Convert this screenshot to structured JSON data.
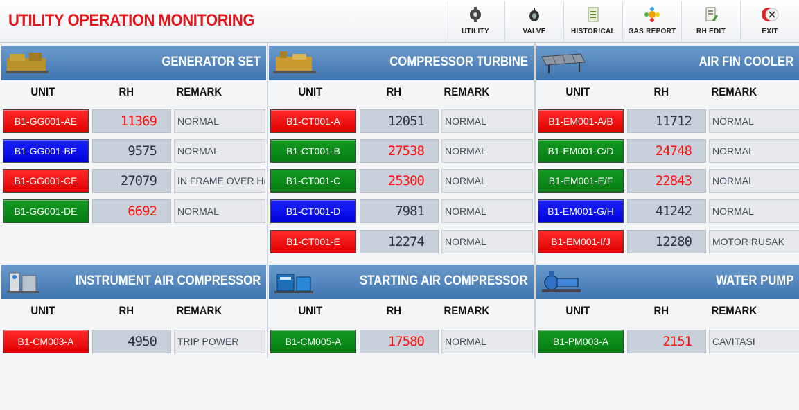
{
  "header": {
    "title": "UTILITY OPERATION MONITORING"
  },
  "toolbar": [
    {
      "label": "UTILITY",
      "icon": "utility-icon"
    },
    {
      "label": "VALVE",
      "icon": "valve-icon"
    },
    {
      "label": "HISTORICAL",
      "icon": "historical-icon"
    },
    {
      "label": "GAS REPORT",
      "icon": "gas-report-icon"
    },
    {
      "label": "RH EDIT",
      "icon": "rh-edit-icon"
    },
    {
      "label": "EXIT",
      "icon": "exit-icon"
    }
  ],
  "columns": {
    "unit": "UNIT",
    "rh": "RH",
    "remark": "REMARK"
  },
  "panels": {
    "generator_set": {
      "title": "GENERATOR SET",
      "rows": [
        {
          "unit": "B1-GG001-AE",
          "color": "red",
          "rh": "11369",
          "rh_color": "red",
          "remark": "NORMAL"
        },
        {
          "unit": "B1-GG001-BE",
          "color": "blue",
          "rh": "9575",
          "rh_color": "dark",
          "remark": "NORMAL"
        },
        {
          "unit": "B1-GG001-CE",
          "color": "red",
          "rh": "27079",
          "rh_color": "dark",
          "remark": "IN FRAME OVER H("
        },
        {
          "unit": "B1-GG001-DE",
          "color": "green",
          "rh": "6692",
          "rh_color": "red",
          "remark": "NORMAL"
        }
      ]
    },
    "compressor_turbine": {
      "title": "COMPRESSOR TURBINE",
      "rows": [
        {
          "unit": "B1-CT001-A",
          "color": "red",
          "rh": "12051",
          "rh_color": "dark",
          "remark": "NORMAL"
        },
        {
          "unit": "B1-CT001-B",
          "color": "green",
          "rh": "27538",
          "rh_color": "red",
          "remark": "NORMAL"
        },
        {
          "unit": "B1-CT001-C",
          "color": "green",
          "rh": "25300",
          "rh_color": "red",
          "remark": "NORMAL"
        },
        {
          "unit": "B1-CT001-D",
          "color": "blue",
          "rh": "7981",
          "rh_color": "dark",
          "remark": "NORMAL"
        },
        {
          "unit": "B1-CT001-E",
          "color": "red",
          "rh": "12274",
          "rh_color": "dark",
          "remark": "NORMAL"
        }
      ]
    },
    "air_fin_cooler": {
      "title": "AIR FIN COOLER",
      "rows": [
        {
          "unit": "B1-EM001-A/B",
          "color": "red",
          "rh": "11712",
          "rh_color": "dark",
          "remark": "NORMAL"
        },
        {
          "unit": "B1-EM001-C/D",
          "color": "green",
          "rh": "24748",
          "rh_color": "red",
          "remark": "NORMAL"
        },
        {
          "unit": "B1-EM001-E/F",
          "color": "green",
          "rh": "22843",
          "rh_color": "red",
          "remark": "NORMAL"
        },
        {
          "unit": "B1-EM001-G/H",
          "color": "blue",
          "rh": "41242",
          "rh_color": "dark",
          "remark": "NORMAL"
        },
        {
          "unit": "B1-EM001-I/J",
          "color": "red",
          "rh": "12280",
          "rh_color": "dark",
          "remark": "MOTOR RUSAK"
        }
      ]
    },
    "instrument_air_compressor": {
      "title": "INSTRUMENT AIR COMPRESSOR",
      "rows": [
        {
          "unit": "B1-CM003-A",
          "color": "red",
          "rh": "4950",
          "rh_color": "dark",
          "remark": "TRIP POWER"
        }
      ]
    },
    "starting_air_compressor": {
      "title": "STARTING AIR COMPRESSOR",
      "rows": [
        {
          "unit": "B1-CM005-A",
          "color": "green",
          "rh": "17580",
          "rh_color": "red",
          "remark": "NORMAL"
        }
      ]
    },
    "water_pump": {
      "title": "WATER PUMP",
      "rows": [
        {
          "unit": "B1-PM003-A",
          "color": "green",
          "rh": "2151",
          "rh_color": "red",
          "remark": "CAVITASI"
        }
      ]
    }
  }
}
